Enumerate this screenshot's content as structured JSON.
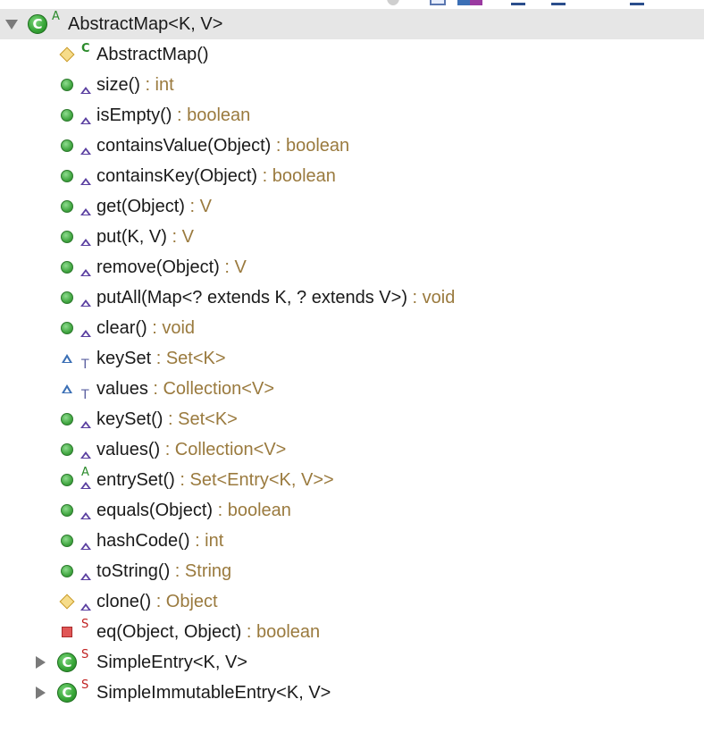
{
  "root": {
    "name": "AbstractMap<K, V>",
    "overlay": "A",
    "icon": "class-icon",
    "expanded": true,
    "children": [
      {
        "kind": "ctor",
        "icon": "diamond",
        "overlay": "C",
        "name": "AbstractMap()",
        "rtype": ""
      },
      {
        "kind": "method",
        "icon": "green-dot",
        "overlay": "tri",
        "name": "size()",
        "rtype": " : int"
      },
      {
        "kind": "method",
        "icon": "green-dot",
        "overlay": "tri",
        "name": "isEmpty()",
        "rtype": " : boolean"
      },
      {
        "kind": "method",
        "icon": "green-dot",
        "overlay": "tri",
        "name": "containsValue(Object)",
        "rtype": " : boolean"
      },
      {
        "kind": "method",
        "icon": "green-dot",
        "overlay": "tri",
        "name": "containsKey(Object)",
        "rtype": " : boolean"
      },
      {
        "kind": "method",
        "icon": "green-dot",
        "overlay": "tri",
        "name": "get(Object)",
        "rtype": " : V"
      },
      {
        "kind": "method",
        "icon": "green-dot",
        "overlay": "tri",
        "name": "put(K, V)",
        "rtype": " : V"
      },
      {
        "kind": "method",
        "icon": "green-dot",
        "overlay": "tri",
        "name": "remove(Object)",
        "rtype": " : V"
      },
      {
        "kind": "method",
        "icon": "green-dot",
        "overlay": "tri",
        "name": "putAll(Map<? extends K, ? extends V>)",
        "rtype": " : void"
      },
      {
        "kind": "method",
        "icon": "green-dot",
        "overlay": "tri",
        "name": "clear()",
        "rtype": " : void"
      },
      {
        "kind": "field",
        "icon": "blue-triangle",
        "overlay": "T",
        "name": "keySet",
        "rtype": " : Set<K>"
      },
      {
        "kind": "field",
        "icon": "blue-triangle",
        "overlay": "T",
        "name": "values",
        "rtype": " : Collection<V>"
      },
      {
        "kind": "method",
        "icon": "green-dot",
        "overlay": "tri",
        "name": "keySet()",
        "rtype": " : Set<K>"
      },
      {
        "kind": "method",
        "icon": "green-dot",
        "overlay": "tri",
        "name": "values()",
        "rtype": " : Collection<V>"
      },
      {
        "kind": "method",
        "icon": "green-dot",
        "overlay": "A-tri",
        "name": "entrySet()",
        "rtype": " : Set<Entry<K, V>>"
      },
      {
        "kind": "method",
        "icon": "green-dot",
        "overlay": "tri",
        "name": "equals(Object)",
        "rtype": " : boolean"
      },
      {
        "kind": "method",
        "icon": "green-dot",
        "overlay": "tri",
        "name": "hashCode()",
        "rtype": " : int"
      },
      {
        "kind": "method",
        "icon": "green-dot",
        "overlay": "tri",
        "name": "toString()",
        "rtype": " : String"
      },
      {
        "kind": "method",
        "icon": "diamond",
        "overlay": "tri",
        "name": "clone()",
        "rtype": " : Object"
      },
      {
        "kind": "method",
        "icon": "red-square",
        "overlay": "S",
        "name": "eq(Object, Object)",
        "rtype": " : boolean"
      }
    ]
  },
  "siblings": [
    {
      "name": "SimpleEntry<K, V>",
      "overlay": "S",
      "expanded": false
    },
    {
      "name": "SimpleImmutableEntry<K, V>",
      "overlay": "S",
      "expanded": false
    }
  ]
}
